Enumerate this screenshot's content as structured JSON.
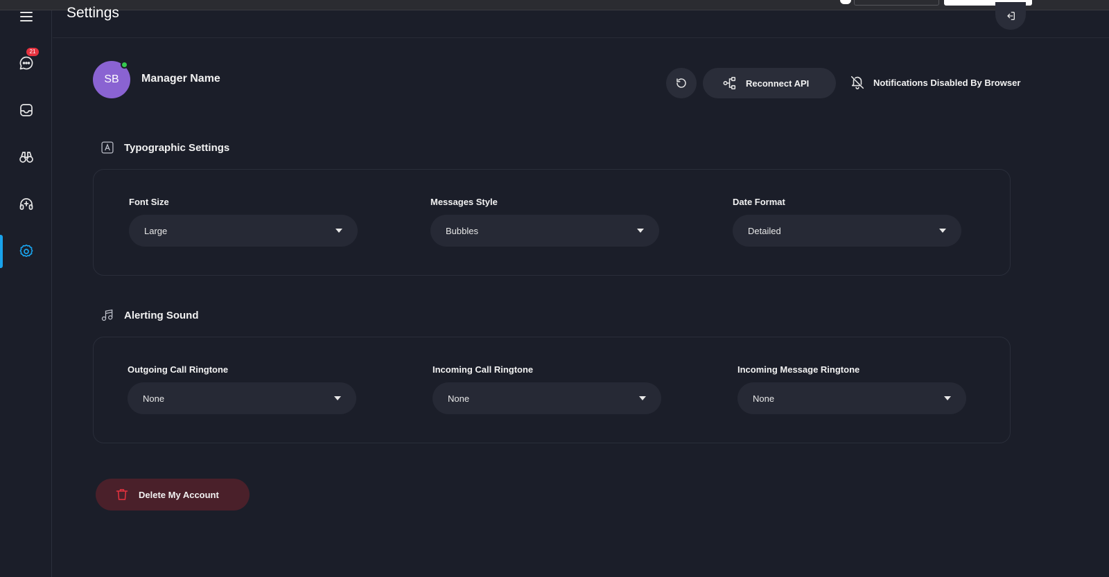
{
  "page": {
    "title": "Settings"
  },
  "sidebar": {
    "items": [
      {
        "name": "chat",
        "icon": "chat-bubble-icon",
        "badge": "21"
      },
      {
        "name": "inbox",
        "icon": "inbox-icon"
      },
      {
        "name": "monitor",
        "icon": "binoculars-icon"
      },
      {
        "name": "support",
        "icon": "headset-icon"
      },
      {
        "name": "settings",
        "icon": "gear-icon",
        "active": true
      }
    ]
  },
  "profile": {
    "initials": "SB",
    "name": "Manager Name",
    "status": "online"
  },
  "actions": {
    "refresh_icon": "refresh-icon",
    "reconnect_label": "Reconnect API",
    "notifications_label": "Notifications Disabled By Browser"
  },
  "typographic": {
    "title": "Typographic Settings",
    "font_size": {
      "label": "Font Size",
      "value": "Large"
    },
    "messages_style": {
      "label": "Messages Style",
      "value": "Bubbles"
    },
    "date_format": {
      "label": "Date Format",
      "value": "Detailed"
    }
  },
  "alerting": {
    "title": "Alerting Sound",
    "outgoing": {
      "label": "Outgoing Call Ringtone",
      "value": "None"
    },
    "incoming_call": {
      "label": "Incoming Call Ringtone",
      "value": "None"
    },
    "incoming_message": {
      "label": "Incoming Message Ringtone",
      "value": "None"
    }
  },
  "danger": {
    "delete_label": "Delete My Account"
  },
  "colors": {
    "background": "#1b1e29",
    "accent": "#19a3ec",
    "avatar": "#8a63d2",
    "online": "#35c94f",
    "badge": "#e5323f",
    "danger_bg": "#4a202a",
    "danger_icon": "#e5323f"
  }
}
